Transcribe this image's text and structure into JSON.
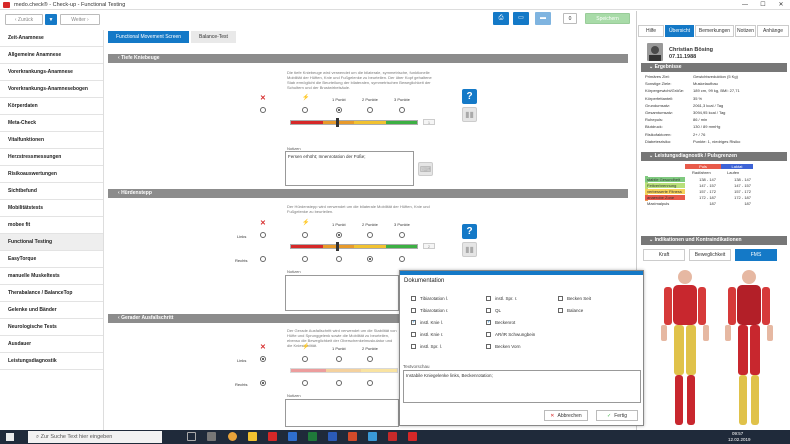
{
  "window": {
    "title": "medo.check® - Check-up - Functional Testing",
    "minimize": "—",
    "maximize": "☐",
    "close": "✕"
  },
  "nav": {
    "back": "Zurück",
    "forward": "Weiter",
    "dropdown": "▼"
  },
  "toolbar": {
    "zoom": "0",
    "save": "Speichern"
  },
  "sidebar": [
    "Zeit-Anamnese",
    "Allgemeine Anamnese",
    "Vorerkrankungs-Anamnese",
    "Vorerkrankungs-Anamnesebogen",
    "Körperdaten",
    "Meta-Check",
    "Vitalfunktionen",
    "Herzstressmessungen",
    "Risikoauswertungen",
    "Sichtbefund",
    "Mobilitätstests",
    "mobee fit",
    "Functional Testing",
    "EasyTorque",
    "manuelle Muskeltests",
    "Therabalance / BalanceTop",
    "Gelenke und Bänder",
    "Neurologische Tests",
    "Ausdauer",
    "Leistungsdiagnostik"
  ],
  "sidebar_active": 12,
  "tabs": [
    "Functional Movement Screen",
    "Balance-Test"
  ],
  "sections": {
    "squat": {
      "title": "Tiefe Kniebeuge",
      "desc": "Die tiefe Kniebeuge wird verwendet um die bilaterale, symmetrische, funktionelle Mobilität der Hüften, Knie und Fußgelenke zu beurteilen. Der über Kopf gehaltene Stab ermöglicht die Beurteilung der bilateralen, symmetrischen Beweglichkeit der Schultern und der Brustwirbelsäule.",
      "opts": [
        "1 Punkt",
        "2 Punkte",
        "3 Punkte"
      ],
      "score": "1",
      "notes_label": "Notizen",
      "notes": "Fersen erhöht; Innenrotation der Füße;"
    },
    "hurdle": {
      "title": "Hürdenstepp",
      "desc": "Der Hürdenstepp wird verwendet um die bilaterale Mobilität der Hüften, Knie und Fußgelenke zu beurteilen.",
      "opts": [
        "1 Punkt",
        "2 Punkte",
        "3 Punkte"
      ],
      "left": "Links",
      "right": "Rechts",
      "score": "2",
      "notes_label": "Notizen"
    },
    "lunge": {
      "title": "Gerader Ausfallschritt",
      "desc": "Der Gerade Ausfallschritt wird verwendet um die Stabilität von Hüfte und Sprunggelenk sowie die Mobilität zu beurteilen, ebenso die Beweglichkeit der Oberschenkelmuskulatur und die Kniestabilität.",
      "opts": [
        "1 Punkt",
        "2 Punkte",
        "3 Punkte"
      ],
      "left": "Links",
      "right": "Rechts",
      "notes_label": "Notizen"
    }
  },
  "right": {
    "tabs": [
      "Hilfe",
      "Übersicht",
      "Bemerkungen",
      "Notizen",
      "Anhänge"
    ],
    "active_tab": 1,
    "patient": {
      "name": "Christian Bösing",
      "dob": "07.11.1988"
    },
    "results_title": "Ergebnisse",
    "results": [
      [
        "Primäres Ziel:",
        "Gewichtsreduktion (5 Kg)"
      ],
      [
        "Sonstige Ziele:",
        "Muskelaufbau"
      ],
      [
        "Körpergewicht/Größe:",
        "189 cm, 99 kg, BMI: 27,71"
      ],
      [
        "Körperfettanteil:",
        "35 %"
      ],
      [
        "Grundumsatz:",
        "2061,3 kcal / Tag"
      ],
      [
        "Gesamtumsatz:",
        "3094,95 kcal / Tag"
      ],
      [
        "Ruhepuls:",
        "86 / min"
      ],
      [
        "Blutdruck:",
        "130 / 89 mmHg"
      ],
      [
        "Risikofaktoren:",
        "2+ / 76"
      ],
      [
        "Diabetesrisiko:",
        "Punkte: 1, niedriges Risiko"
      ]
    ],
    "puls_title": "Leistungsdiagnostik / Pulsgrenzen",
    "puls_head": {
      "a": "Puls",
      "b": "Laktat",
      "c": "Radfahren",
      "d": "Laufen"
    },
    "puls_rows": [
      {
        "name": "stabile Gesundheit",
        "a": "138 - 147",
        "b": "138 - 147",
        "color": "#7fc97f"
      },
      {
        "name": "Fettverbrennung",
        "a": "147 - 157",
        "b": "147 - 157",
        "color": "#b8e07a"
      },
      {
        "name": "verbesserte Fitness",
        "a": "157 - 172",
        "b": "157 - 172",
        "color": "#f5d25a"
      },
      {
        "name": "anaerobe Zone",
        "a": "172 - 187",
        "b": "172 - 187",
        "color": "#e85a4a"
      },
      {
        "name": "Maximalpuls",
        "a": "187",
        "b": "187",
        "color": "#ffffff"
      }
    ],
    "ind_title": "Indikationen und Kontraindikationen",
    "ind_btns": [
      "Kraft",
      "Beweglichkeit",
      "FMS"
    ],
    "ind_active": 2
  },
  "dialog": {
    "title": "Dokumentation",
    "checks": [
      {
        "label": "Tibiarotation l.",
        "on": false
      },
      {
        "label": "instl. Spr. r.",
        "on": false
      },
      {
        "label": "Becken Seit",
        "on": false
      },
      {
        "label": "Tibiarotation r.",
        "on": false
      },
      {
        "label": "QL",
        "on": false
      },
      {
        "label": "Balance",
        "on": false
      },
      {
        "label": "instl. Knie l.",
        "on": true
      },
      {
        "label": "Beckenrot",
        "on": true
      },
      {
        "label": "instl. Knie r.",
        "on": false
      },
      {
        "label": "AR/IR Schwungbein",
        "on": false
      },
      {
        "label": "instl. Spr. l.",
        "on": false
      },
      {
        "label": "Becken Vorn",
        "on": false
      }
    ],
    "text_label": "Textvorschau",
    "text": "Instabile Kniegelenke links, Beckenrotation;",
    "cancel": "Abbrechen",
    "ok": "Fertig"
  },
  "taskbar": {
    "search": "Zur Suche Text hier eingeben",
    "time": "09:57",
    "date": "12.02.2019"
  },
  "colors": {
    "accent": "#1479c7",
    "red": "#d62828",
    "green": "#3cb043",
    "yellow": "#f2c230",
    "orange": "#e89a2a"
  }
}
